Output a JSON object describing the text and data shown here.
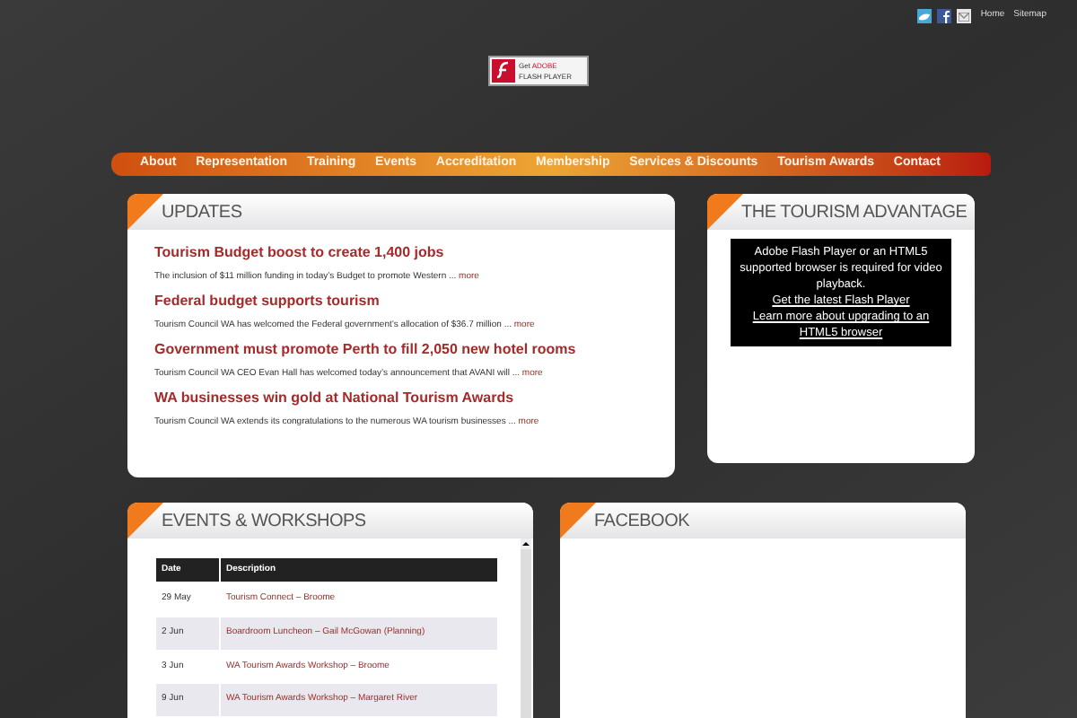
{
  "top_links": [
    "Home",
    "Sitemap"
  ],
  "flash_badge": {
    "line1": "Get",
    "brand": "ADOBE",
    "line2": "FLASH PLAYER"
  },
  "nav": [
    "About",
    "Representation",
    "Training",
    "Events",
    "Accreditation",
    "Membership",
    "Services & Discounts",
    "Tourism Awards",
    "Contact"
  ],
  "updates": {
    "title": "UPDATES",
    "items": [
      {
        "headline": "Tourism Budget boost to create 1,400 jobs",
        "summary": "The inclusion of $11 million funding in today’s Budget to promote Western ...",
        "more": "more"
      },
      {
        "headline": "Federal budget supports tourism",
        "summary": "Tourism Council WA has welcomed the Federal government’s allocation of $36.7 million ...",
        "more": "more"
      },
      {
        "headline": "Government must promote Perth to fill 2,050 new hotel rooms",
        "summary": "Tourism Council WA CEO Evan Hall has welcomed today’s announcement that AVANI will ...",
        "more": "more"
      },
      {
        "headline": "WA businesses win gold at National Tourism Awards",
        "summary": "Tourism Council WA extends its congratulations to the numerous WA tourism businesses ...",
        "more": "more"
      }
    ]
  },
  "advantage": {
    "title": "THE TOURISM ADVANTAGE",
    "message": "Adobe Flash Player or an HTML5 supported browser is required for video playback.",
    "links": [
      "Get the latest Flash Player",
      "Learn more about upgrading to an HTML5 browser"
    ]
  },
  "events": {
    "title": "EVENTS & WORKSHOPS",
    "columns": [
      "Date",
      "Description"
    ],
    "rows": [
      {
        "date": "29 May",
        "description": "Tourism Connect – Broome"
      },
      {
        "date": "2 Jun",
        "description": "Boardroom Luncheon – Gail McGowan (Planning)"
      },
      {
        "date": "3 Jun",
        "description": "WA Tourism Awards Workshop – Broome"
      },
      {
        "date": "9 Jun",
        "description": "WA Tourism Awards Workshop – Margaret River"
      }
    ]
  },
  "facebook": {
    "title": "FACEBOOK"
  }
}
